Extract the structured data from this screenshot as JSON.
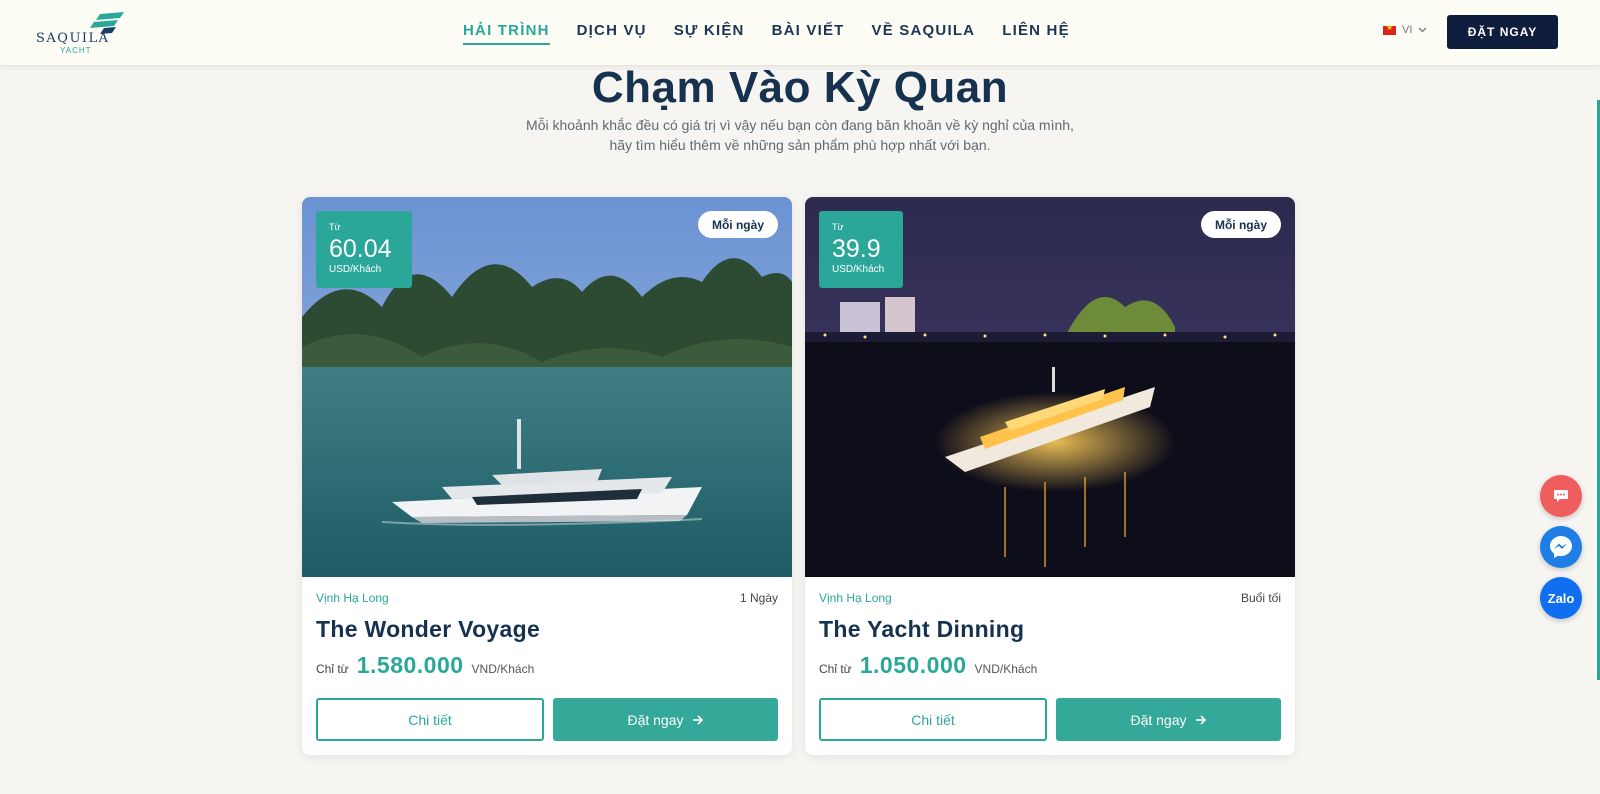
{
  "header": {
    "logo_text": "SAQUILA",
    "logo_sub": "YACHT",
    "nav": [
      {
        "label": "HẢI TRÌNH",
        "active": true
      },
      {
        "label": "DỊCH VỤ",
        "active": false
      },
      {
        "label": "SỰ KIỆN",
        "active": false
      },
      {
        "label": "BÀI VIẾT",
        "active": false
      },
      {
        "label": "VỀ SAQUILA",
        "active": false
      },
      {
        "label": "LIÊN HỆ",
        "active": false
      }
    ],
    "language": "VI",
    "book_button": "ĐẶT NGAY"
  },
  "section": {
    "title": "Chạm Vào Kỳ Quan",
    "subtitle": "Mỗi khoảnh khắc đều có giá trị vì vậy nếu bạn còn đang băn khoăn về kỳ nghỉ của mình, hãy tìm hiểu thêm về những sản phẩm phù hợp nhất với bạn."
  },
  "cards": [
    {
      "badge_from": "Từ",
      "badge_amount": "60.04",
      "badge_unit": "USD/Khách",
      "schedule": "Mỗi ngày",
      "location": "Vịnh Hạ Long",
      "duration": "1 Ngày",
      "name": "The Wonder Voyage",
      "price_prefix": "Chỉ từ",
      "price": "1.580.000",
      "price_unit": "VND/Khách",
      "detail_button": "Chi tiết",
      "book_button": "Đặt ngay"
    },
    {
      "badge_from": "Từ",
      "badge_amount": "39.9",
      "badge_unit": "USD/Khách",
      "schedule": "Mỗi ngày",
      "location": "Vịnh Hạ Long",
      "duration": "Buổi tối",
      "name": "The Yacht Dinning",
      "price_prefix": "Chỉ từ",
      "price": "1.050.000",
      "price_unit": "VND/Khách",
      "detail_button": "Chi tiết",
      "book_button": "Đặt ngay"
    }
  ],
  "floating": {
    "zalo_label": "Zalo"
  },
  "colors": {
    "accent": "#2ba79a",
    "navy": "#0f1e3d",
    "background": "#f6f5f1"
  }
}
